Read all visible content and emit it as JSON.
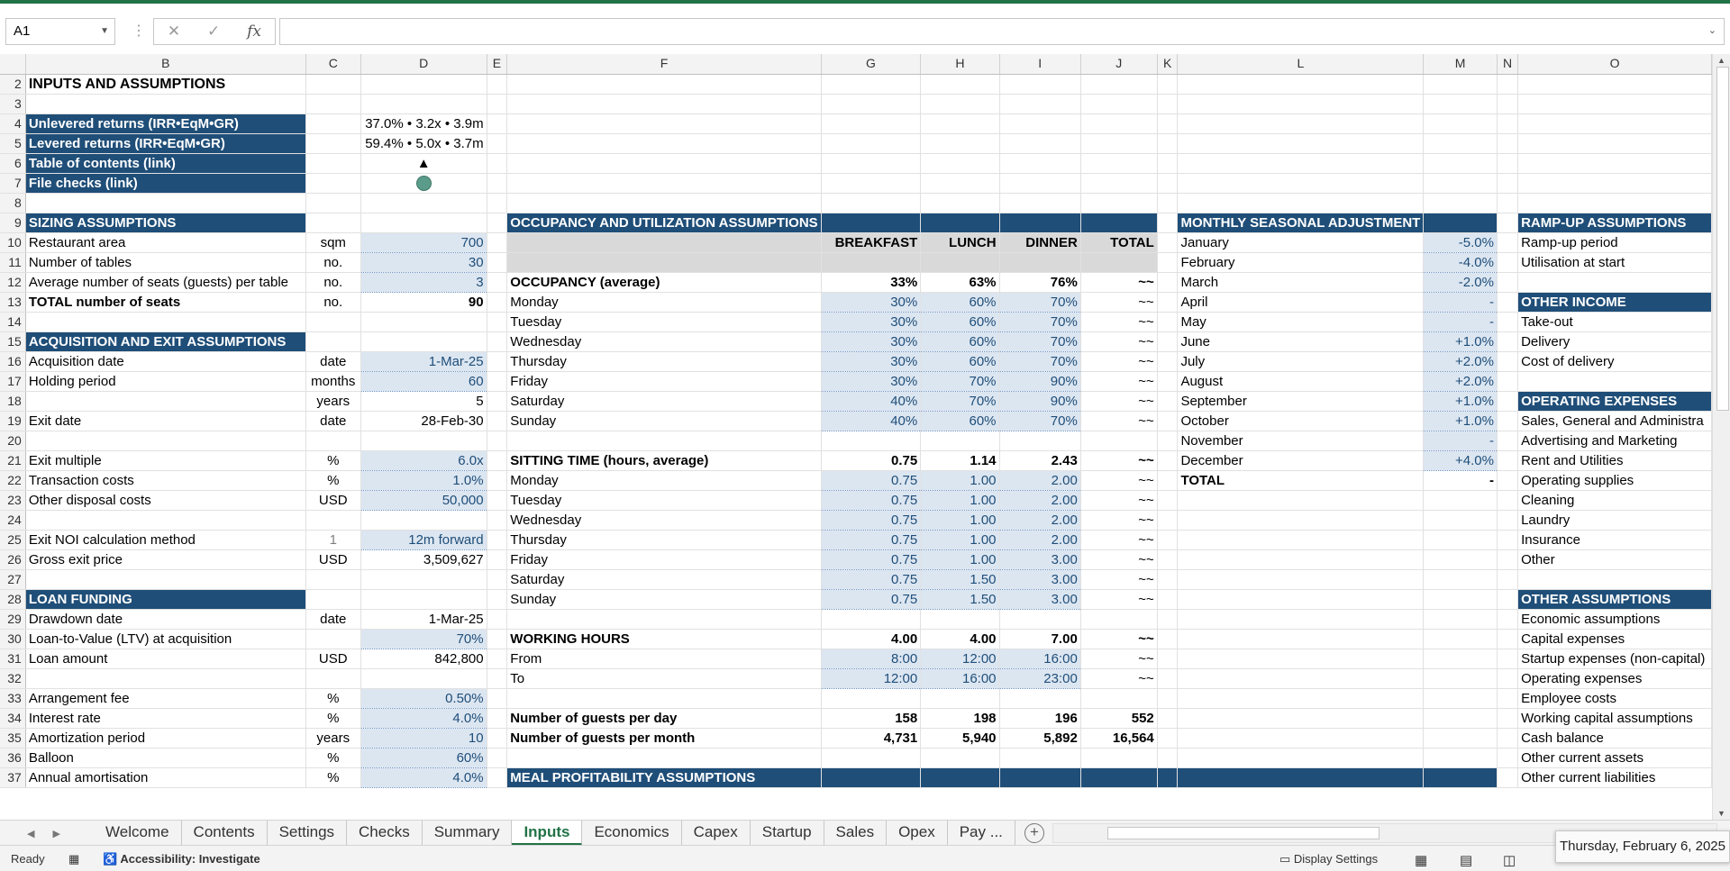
{
  "app": {
    "accent": "#217346",
    "header_fill": "#1f4e78",
    "input_fill": "#dce6f1"
  },
  "formula_bar": {
    "name_box": "A1",
    "formula": "",
    "fx_label": "fx"
  },
  "columns": [
    "",
    "B",
    "C",
    "D",
    "E",
    "F",
    "G",
    "H",
    "I",
    "J",
    "K",
    "L",
    "M",
    "N",
    "O"
  ],
  "rows": {
    "r2": {
      "rn": "2",
      "b": "INPUTS AND ASSUMPTIONS"
    },
    "r3": {
      "rn": "3"
    },
    "r4": {
      "rn": "4",
      "b": "Unlevered returns (IRR•EqM•GR)",
      "d": "37.0% • 3.2x • 3.9m"
    },
    "r5": {
      "rn": "5",
      "b": "Levered returns (IRR•EqM•GR)",
      "d": "59.4% • 5.0x • 3.7m"
    },
    "r6": {
      "rn": "6",
      "b": "Table of contents (link)",
      "d": "▲"
    },
    "r7": {
      "rn": "7",
      "b": "File checks (link)"
    },
    "r8": {
      "rn": "8"
    },
    "r9": {
      "rn": "9",
      "b": "SIZING ASSUMPTIONS",
      "f": "OCCUPANCY AND UTILIZATION ASSUMPTIONS",
      "l": "MONTHLY SEASONAL ADJUSTMENT",
      "o": "RAMP-UP ASSUMPTIONS"
    },
    "r10": {
      "rn": "10",
      "b": "Restaurant area",
      "c": "sqm",
      "d": "700",
      "g": "BREAKFAST",
      "h": "LUNCH",
      "i": "DINNER",
      "j": "TOTAL",
      "l": "January",
      "m": "-5.0%",
      "o": "Ramp-up period"
    },
    "r11": {
      "rn": "11",
      "b": "Number of tables",
      "c": "no.",
      "d": "30",
      "l": "February",
      "m": "-4.0%",
      "o": "Utilisation at start"
    },
    "r12": {
      "rn": "12",
      "b": "Average number of seats (guests) per table",
      "c": "no.",
      "d": "3",
      "f": "OCCUPANCY (average)",
      "g": "33%",
      "h": "63%",
      "i": "76%",
      "j": "~~",
      "l": "March",
      "m": "-2.0%"
    },
    "r13": {
      "rn": "13",
      "b": "TOTAL number of seats",
      "c": "no.",
      "d": "90",
      "f": "Monday",
      "g": "30%",
      "h": "60%",
      "i": "70%",
      "j": "~~",
      "l": "April",
      "m": "-",
      "o": "OTHER INCOME"
    },
    "r14": {
      "rn": "14",
      "f": "Tuesday",
      "g": "30%",
      "h": "60%",
      "i": "70%",
      "j": "~~",
      "l": "May",
      "m": "-",
      "o": "Take-out"
    },
    "r15": {
      "rn": "15",
      "b": "ACQUISITION AND EXIT ASSUMPTIONS",
      "f": "Wednesday",
      "g": "30%",
      "h": "60%",
      "i": "70%",
      "j": "~~",
      "l": "June",
      "m": "+1.0%",
      "o": "Delivery"
    },
    "r16": {
      "rn": "16",
      "b": "Acquisition date",
      "c": "date",
      "d": "1-Mar-25",
      "f": "Thursday",
      "g": "30%",
      "h": "60%",
      "i": "70%",
      "j": "~~",
      "l": "July",
      "m": "+2.0%",
      "o": "Cost of delivery"
    },
    "r17": {
      "rn": "17",
      "b": "Holding period",
      "c": "months",
      "d": "60",
      "f": "Friday",
      "g": "30%",
      "h": "70%",
      "i": "90%",
      "j": "~~",
      "l": "August",
      "m": "+2.0%"
    },
    "r18": {
      "rn": "18",
      "c": "years",
      "d": "5",
      "f": "Saturday",
      "g": "40%",
      "h": "70%",
      "i": "90%",
      "j": "~~",
      "l": "September",
      "m": "+1.0%",
      "o": "OPERATING EXPENSES"
    },
    "r19": {
      "rn": "19",
      "b": "Exit date",
      "c": "date",
      "d": "28-Feb-30",
      "f": "Sunday",
      "g": "40%",
      "h": "60%",
      "i": "70%",
      "j": "~~",
      "l": "October",
      "m": "+1.0%",
      "o": "Sales, General and Administra"
    },
    "r20": {
      "rn": "20",
      "l": "November",
      "m": "-",
      "o": "Advertising and Marketing"
    },
    "r21": {
      "rn": "21",
      "b": "Exit multiple",
      "c": "%",
      "d": "6.0x",
      "f": "SITTING TIME (hours, average)",
      "g": "0.75",
      "h": "1.14",
      "i": "2.43",
      "j": "~~",
      "l": "December",
      "m": "+4.0%",
      "o": "Rent and Utilities"
    },
    "r22": {
      "rn": "22",
      "b": "Transaction costs",
      "c": "%",
      "d": "1.0%",
      "f": "Monday",
      "g": "0.75",
      "h": "1.00",
      "i": "2.00",
      "j": "~~",
      "l": "TOTAL",
      "m": "-",
      "o": "Operating supplies"
    },
    "r23": {
      "rn": "23",
      "b": "Other disposal costs",
      "c": "USD",
      "d": "50,000",
      "f": "Tuesday",
      "g": "0.75",
      "h": "1.00",
      "i": "2.00",
      "j": "~~",
      "o": "Cleaning"
    },
    "r24": {
      "rn": "24",
      "f": "Wednesday",
      "g": "0.75",
      "h": "1.00",
      "i": "2.00",
      "j": "~~",
      "o": "Laundry"
    },
    "r25": {
      "rn": "25",
      "b": "Exit NOI calculation method",
      "c": "1",
      "d": "12m forward",
      "f": "Thursday",
      "g": "0.75",
      "h": "1.00",
      "i": "2.00",
      "j": "~~",
      "o": "Insurance"
    },
    "r26": {
      "rn": "26",
      "b": "Gross exit price",
      "c": "USD",
      "d": "3,509,627",
      "f": "Friday",
      "g": "0.75",
      "h": "1.00",
      "i": "3.00",
      "j": "~~",
      "o": "Other"
    },
    "r27": {
      "rn": "27",
      "f": "Saturday",
      "g": "0.75",
      "h": "1.50",
      "i": "3.00",
      "j": "~~"
    },
    "r28": {
      "rn": "28",
      "b": "LOAN FUNDING",
      "f": "Sunday",
      "g": "0.75",
      "h": "1.50",
      "i": "3.00",
      "j": "~~",
      "o": "OTHER ASSUMPTIONS"
    },
    "r29": {
      "rn": "29",
      "b": "Drawdown date",
      "c": "date",
      "d": "1-Mar-25",
      "o": "Economic assumptions"
    },
    "r30": {
      "rn": "30",
      "b": "Loan-to-Value (LTV) at acquisition",
      "d": "70%",
      "f": "WORKING HOURS",
      "g": "4.00",
      "h": "4.00",
      "i": "7.00",
      "j": "~~",
      "o": "Capital expenses"
    },
    "r31": {
      "rn": "31",
      "b": "Loan amount",
      "c": "USD",
      "d": "842,800",
      "f": "From",
      "g": "8:00",
      "h": "12:00",
      "i": "16:00",
      "j": "~~",
      "o": "Startup expenses (non-capital)"
    },
    "r32": {
      "rn": "32",
      "f": "To",
      "g": "12:00",
      "h": "16:00",
      "i": "23:00",
      "j": "~~",
      "o": "Operating expenses"
    },
    "r33": {
      "rn": "33",
      "b": "Arrangement fee",
      "c": "%",
      "d": "0.50%",
      "o": "Employee costs"
    },
    "r34": {
      "rn": "34",
      "b": "Interest rate",
      "c": "%",
      "d": "4.0%",
      "f": "Number of guests per day",
      "g": "158",
      "h": "198",
      "i": "196",
      "j": "552",
      "o": "Working capital assumptions"
    },
    "r35": {
      "rn": "35",
      "b": "Amortization period",
      "c": "years",
      "d": "10",
      "f": "Number of guests per month",
      "g": "4,731",
      "h": "5,940",
      "i": "5,892",
      "j": "16,564",
      "o": "Cash balance"
    },
    "r36": {
      "rn": "36",
      "b": "Balloon",
      "c": "%",
      "d": "60%",
      "o": "Other current assets"
    },
    "r37": {
      "rn": "37",
      "b": "Annual amortisation",
      "c": "%",
      "d": "4.0%",
      "f": "MEAL PROFITABILITY ASSUMPTIONS",
      "o": "Other current liabilities"
    }
  },
  "tabs": [
    "Welcome",
    "Contents",
    "Settings",
    "Checks",
    "Summary",
    "Inputs",
    "Economics",
    "Capex",
    "Startup",
    "Sales",
    "Opex",
    "Pay ..."
  ],
  "active_tab": "Inputs",
  "status": {
    "ready": "Ready",
    "accessibility": "Accessibility: Investigate",
    "display_settings": "Display Settings",
    "date": "Thursday, February 6, 2025"
  }
}
